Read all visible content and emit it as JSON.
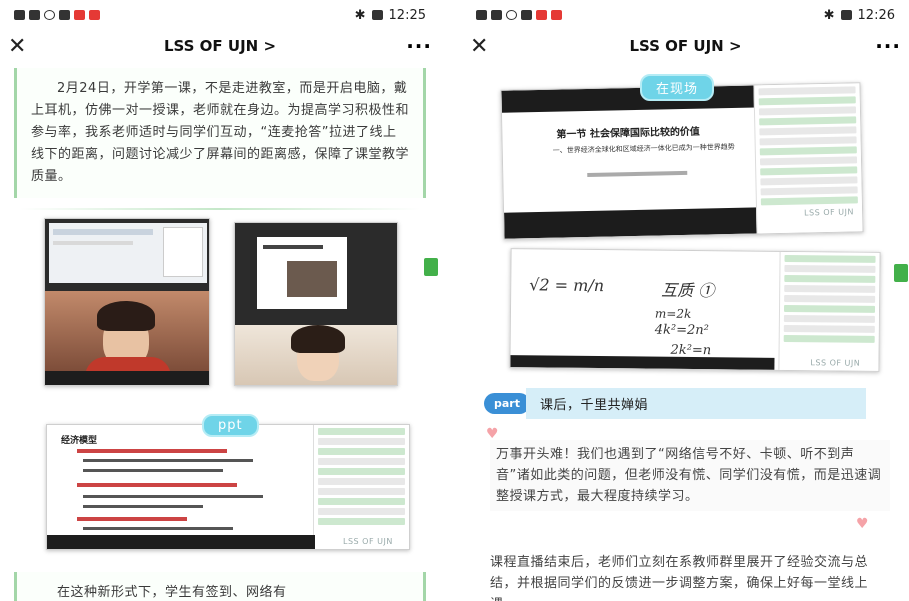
{
  "left": {
    "status_time": "12:25",
    "title": "LSS OF UJN >",
    "para1": "2月24日，开学第一课，不是走进教室，而是开启电脑，戴上耳机，仿佛一对一授课，老师就在身边。为提高学习积极性和参与率，我系老师适时与同学们互动，“连麦抢答”拉进了线上线下的距离，问题讨论减少了屏幕间的距离感，保障了课堂教学质量。",
    "ppt_tag": "ppt",
    "slide_title": "经济模型",
    "watermark": "LSS OF UJN",
    "para2": "在这种新形式下，学生有签到、网络有"
  },
  "right": {
    "status_time": "12:26",
    "title": "LSS OF UJN >",
    "scene_tag": "在现场",
    "slide_title": "第一节 社会保障国际比较的价值",
    "slide_sub": "一、世界经济全球化和区域经济一体化已成为一种世界趋势",
    "part_label": "part",
    "part_title": "课后，千里共婵娟",
    "para1": "万事开头难！我们也遇到了“网络信号不好、卡顿、听不到声音”诸如此类的问题，但老师没有慌、同学们没有慌，而是迅速调整授课方式，最大程度持续学习。",
    "para2": "课程直播结束后，老师们立刻在系教师群里展开了经验交流与总结，并根据同学们的反馈进一步调整方案，确保上好每一堂线上课。",
    "watermark": "LSS OF UJN",
    "hw_line1": "m=2k",
    "hw_line2": "4k²=2n²",
    "hw_line3": "2k²=n",
    "hw_line4": "√2 = m/n",
    "hw_line5": "互质 ①"
  }
}
